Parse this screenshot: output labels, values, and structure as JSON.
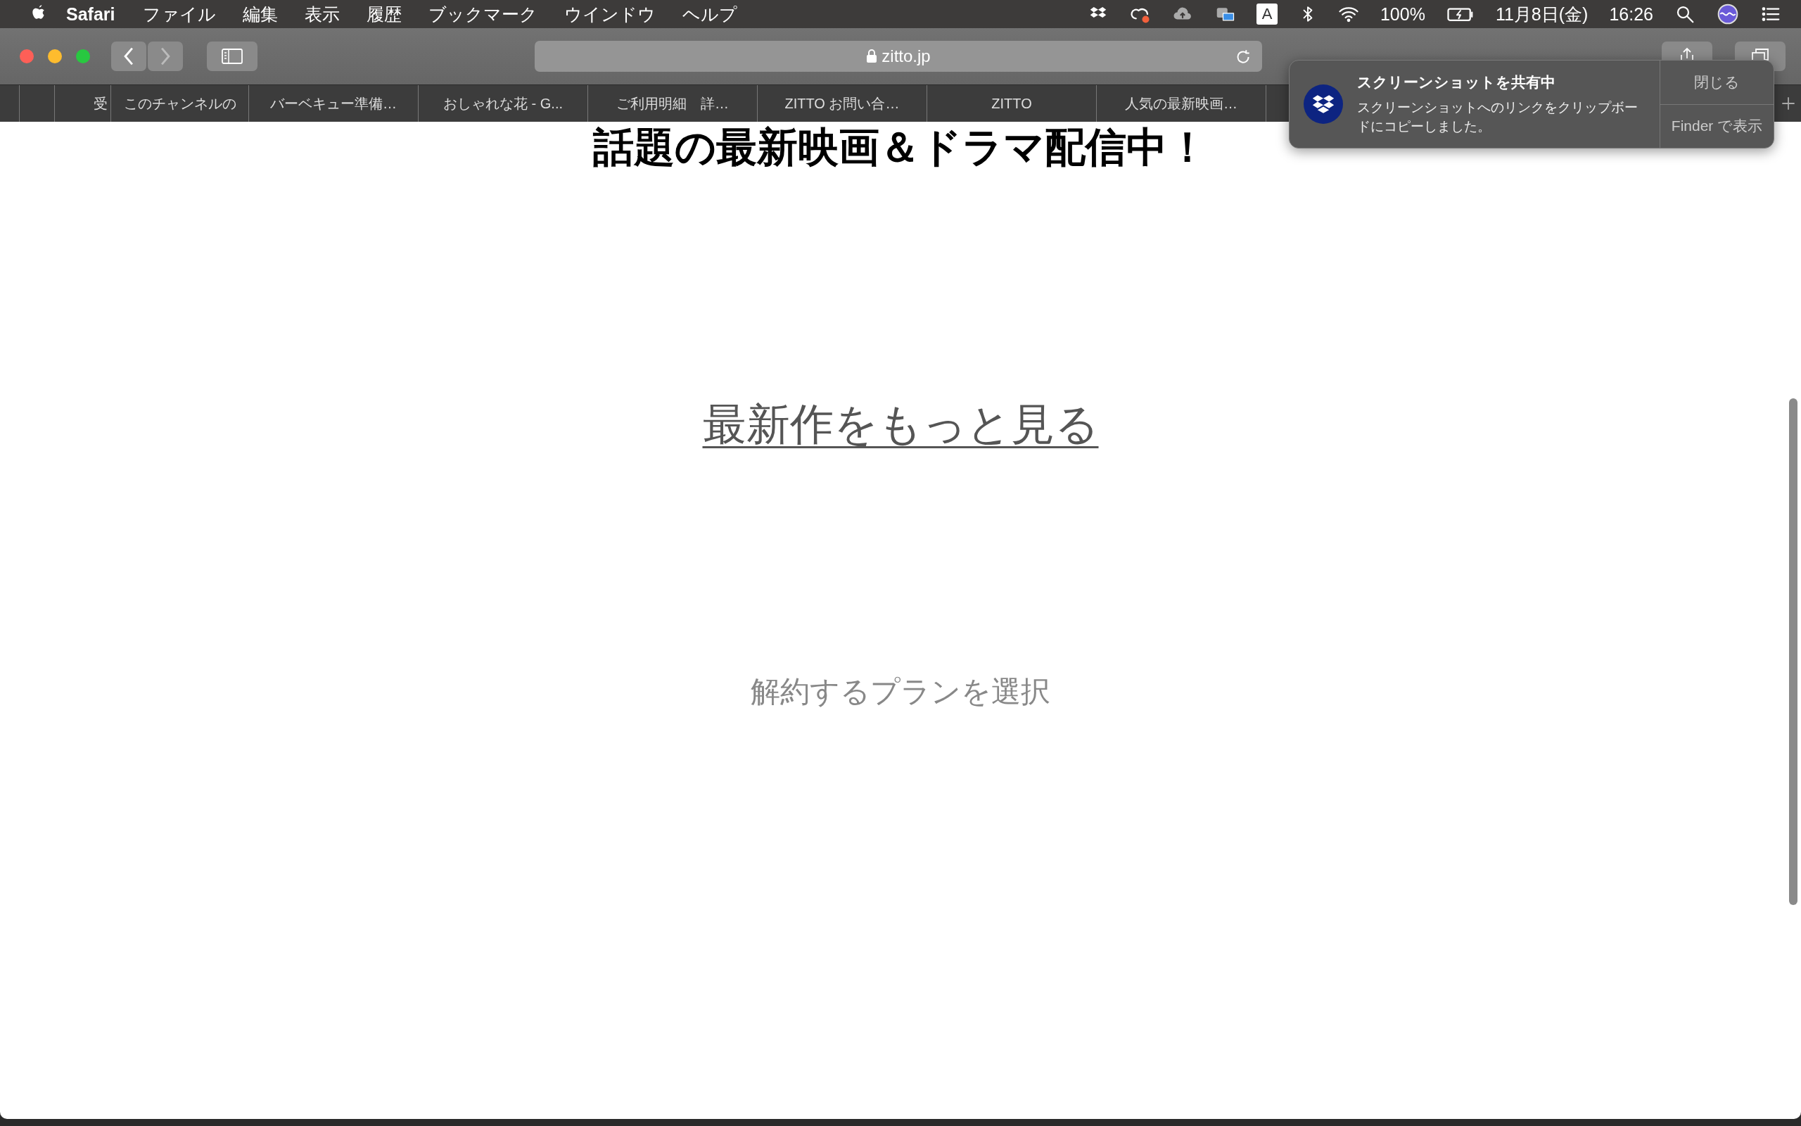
{
  "menu_bar": {
    "app": "Safari",
    "items": [
      "ファイル",
      "編集",
      "表示",
      "履歴",
      "ブックマーク",
      "ウインドウ",
      "ヘルプ"
    ],
    "input_source": "A",
    "battery": "100%",
    "date": "11月8日(金)",
    "time": "16:26"
  },
  "toolbar": {
    "url": "zitto.jp"
  },
  "tabs": [
    {
      "label": "受"
    },
    {
      "label": "このチャンネルの"
    },
    {
      "label": "バーベキュー準備…"
    },
    {
      "label": "おしゃれな花 - G..."
    },
    {
      "label": "ご利用明細　詳…"
    },
    {
      "label": "ZITTO お問い合…"
    },
    {
      "label": "ZITTO"
    },
    {
      "label": "人気の最新映画…"
    }
  ],
  "page": {
    "heading": "話題の最新映画＆ドラマ配信中！",
    "link": "最新作をもっと見る",
    "text": "解約するプランを選択"
  },
  "notification": {
    "title": "スクリーンショットを共有中",
    "body": "スクリーンショットへのリンクをクリップボードにコピーしました。",
    "buttons": [
      "閉じる",
      "Finder で表示"
    ]
  }
}
